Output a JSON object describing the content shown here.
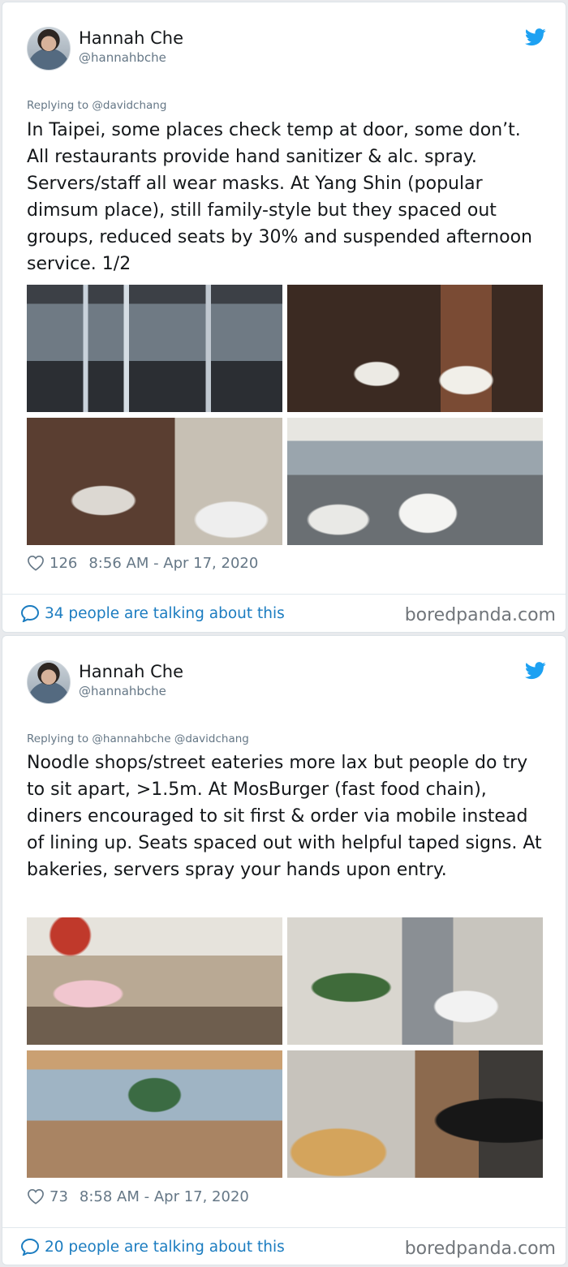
{
  "tweets": [
    {
      "author": {
        "name": "Hannah Che",
        "handle": "@hannahbche",
        "avatar": "avatar-icon"
      },
      "replying_to": "Replying to @davidchang",
      "text": "In Taipei, some places check temp at door, some don’t. All restaurants provide hand sanitizer & alc. spray. Servers/staff all wear masks. At Yang Shin (popular dimsum place), still family-style but they spaced out groups, reduced seats by 30% and suspended afternoon service. 1/2",
      "photos": [
        "restaurant-entrance-photo",
        "dining-room-photo",
        "booth-seating-photo",
        "dining-hall-photo"
      ],
      "likes": "126",
      "timestamp": "8:56 AM - Apr 17, 2020",
      "talking": "34 people are talking about this",
      "source": "boredpanda.com"
    },
    {
      "author": {
        "name": "Hannah Che",
        "handle": "@hannahbche",
        "avatar": "avatar-icon"
      },
      "replying_to": "Replying to @hannahbche @davidchang",
      "text": "Noodle shops/street eateries more lax but people do try to sit apart, >1.5m. At MosBurger (fast food chain), diners encouraged to sit first & order via mobile instead of lining up. Seats spaced out with helpful taped signs. At bakeries, servers spray your hands upon entry.",
      "photos": [
        "noodle-shop-photo",
        "mosburger-signs-photo",
        "cafe-seating-photo",
        "bakery-spray-photo"
      ],
      "likes": "73",
      "timestamp": "8:58 AM - Apr 17, 2020",
      "talking": "20 people are talking about this",
      "source": "boredpanda.com"
    }
  ],
  "colors": {
    "link": "#1b7cc0",
    "twitter_blue": "#1da1f2",
    "muted": "#657786"
  }
}
